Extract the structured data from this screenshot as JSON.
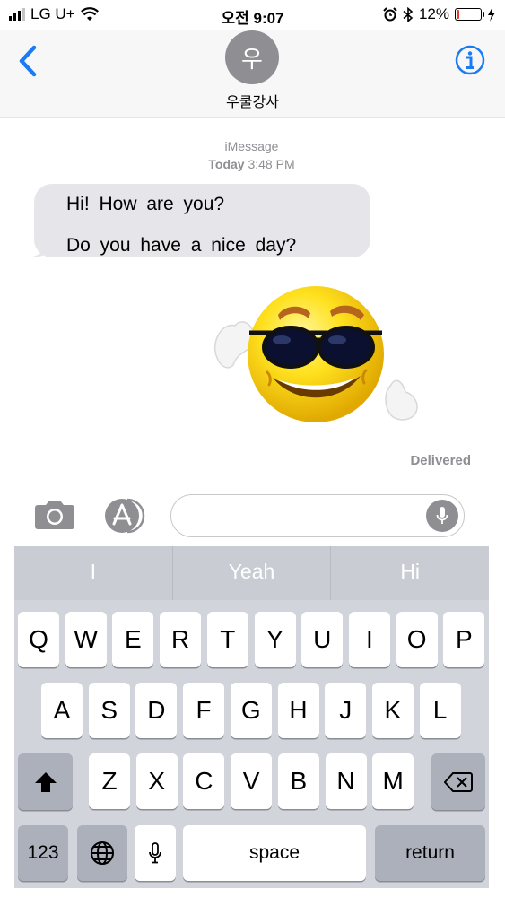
{
  "status_bar": {
    "carrier": "LG U+",
    "time": "오전 9:07",
    "battery_percent": "12%",
    "battery_level": 0.12,
    "icons": [
      "signal-icon",
      "wifi-icon",
      "alarm-icon",
      "bluetooth-icon",
      "battery-icon",
      "charging-icon"
    ]
  },
  "header": {
    "avatar_initial": "우",
    "contact_name": "우쿨강사",
    "accent": "#1a7cf5"
  },
  "conversation": {
    "service": "iMessage",
    "day": "Today",
    "time": "3:48 PM",
    "incoming": [
      "Hi! How are you?",
      "Do you have a nice day?"
    ],
    "sticker": "sunglasses-smiley-sticker",
    "status": "Delivered"
  },
  "input": {
    "placeholder": "",
    "icons": [
      "camera-icon",
      "app-store-icon",
      "microphone-icon"
    ]
  },
  "keyboard": {
    "suggestions": [
      "I",
      "Yeah",
      "Hi"
    ],
    "row1": [
      "Q",
      "W",
      "E",
      "R",
      "T",
      "Y",
      "U",
      "I",
      "O",
      "P"
    ],
    "row2": [
      "A",
      "S",
      "D",
      "F",
      "G",
      "H",
      "J",
      "K",
      "L"
    ],
    "row3": [
      "Z",
      "X",
      "C",
      "V",
      "B",
      "N",
      "M"
    ],
    "numbers_label": "123",
    "space_label": "space",
    "return_label": "return"
  }
}
